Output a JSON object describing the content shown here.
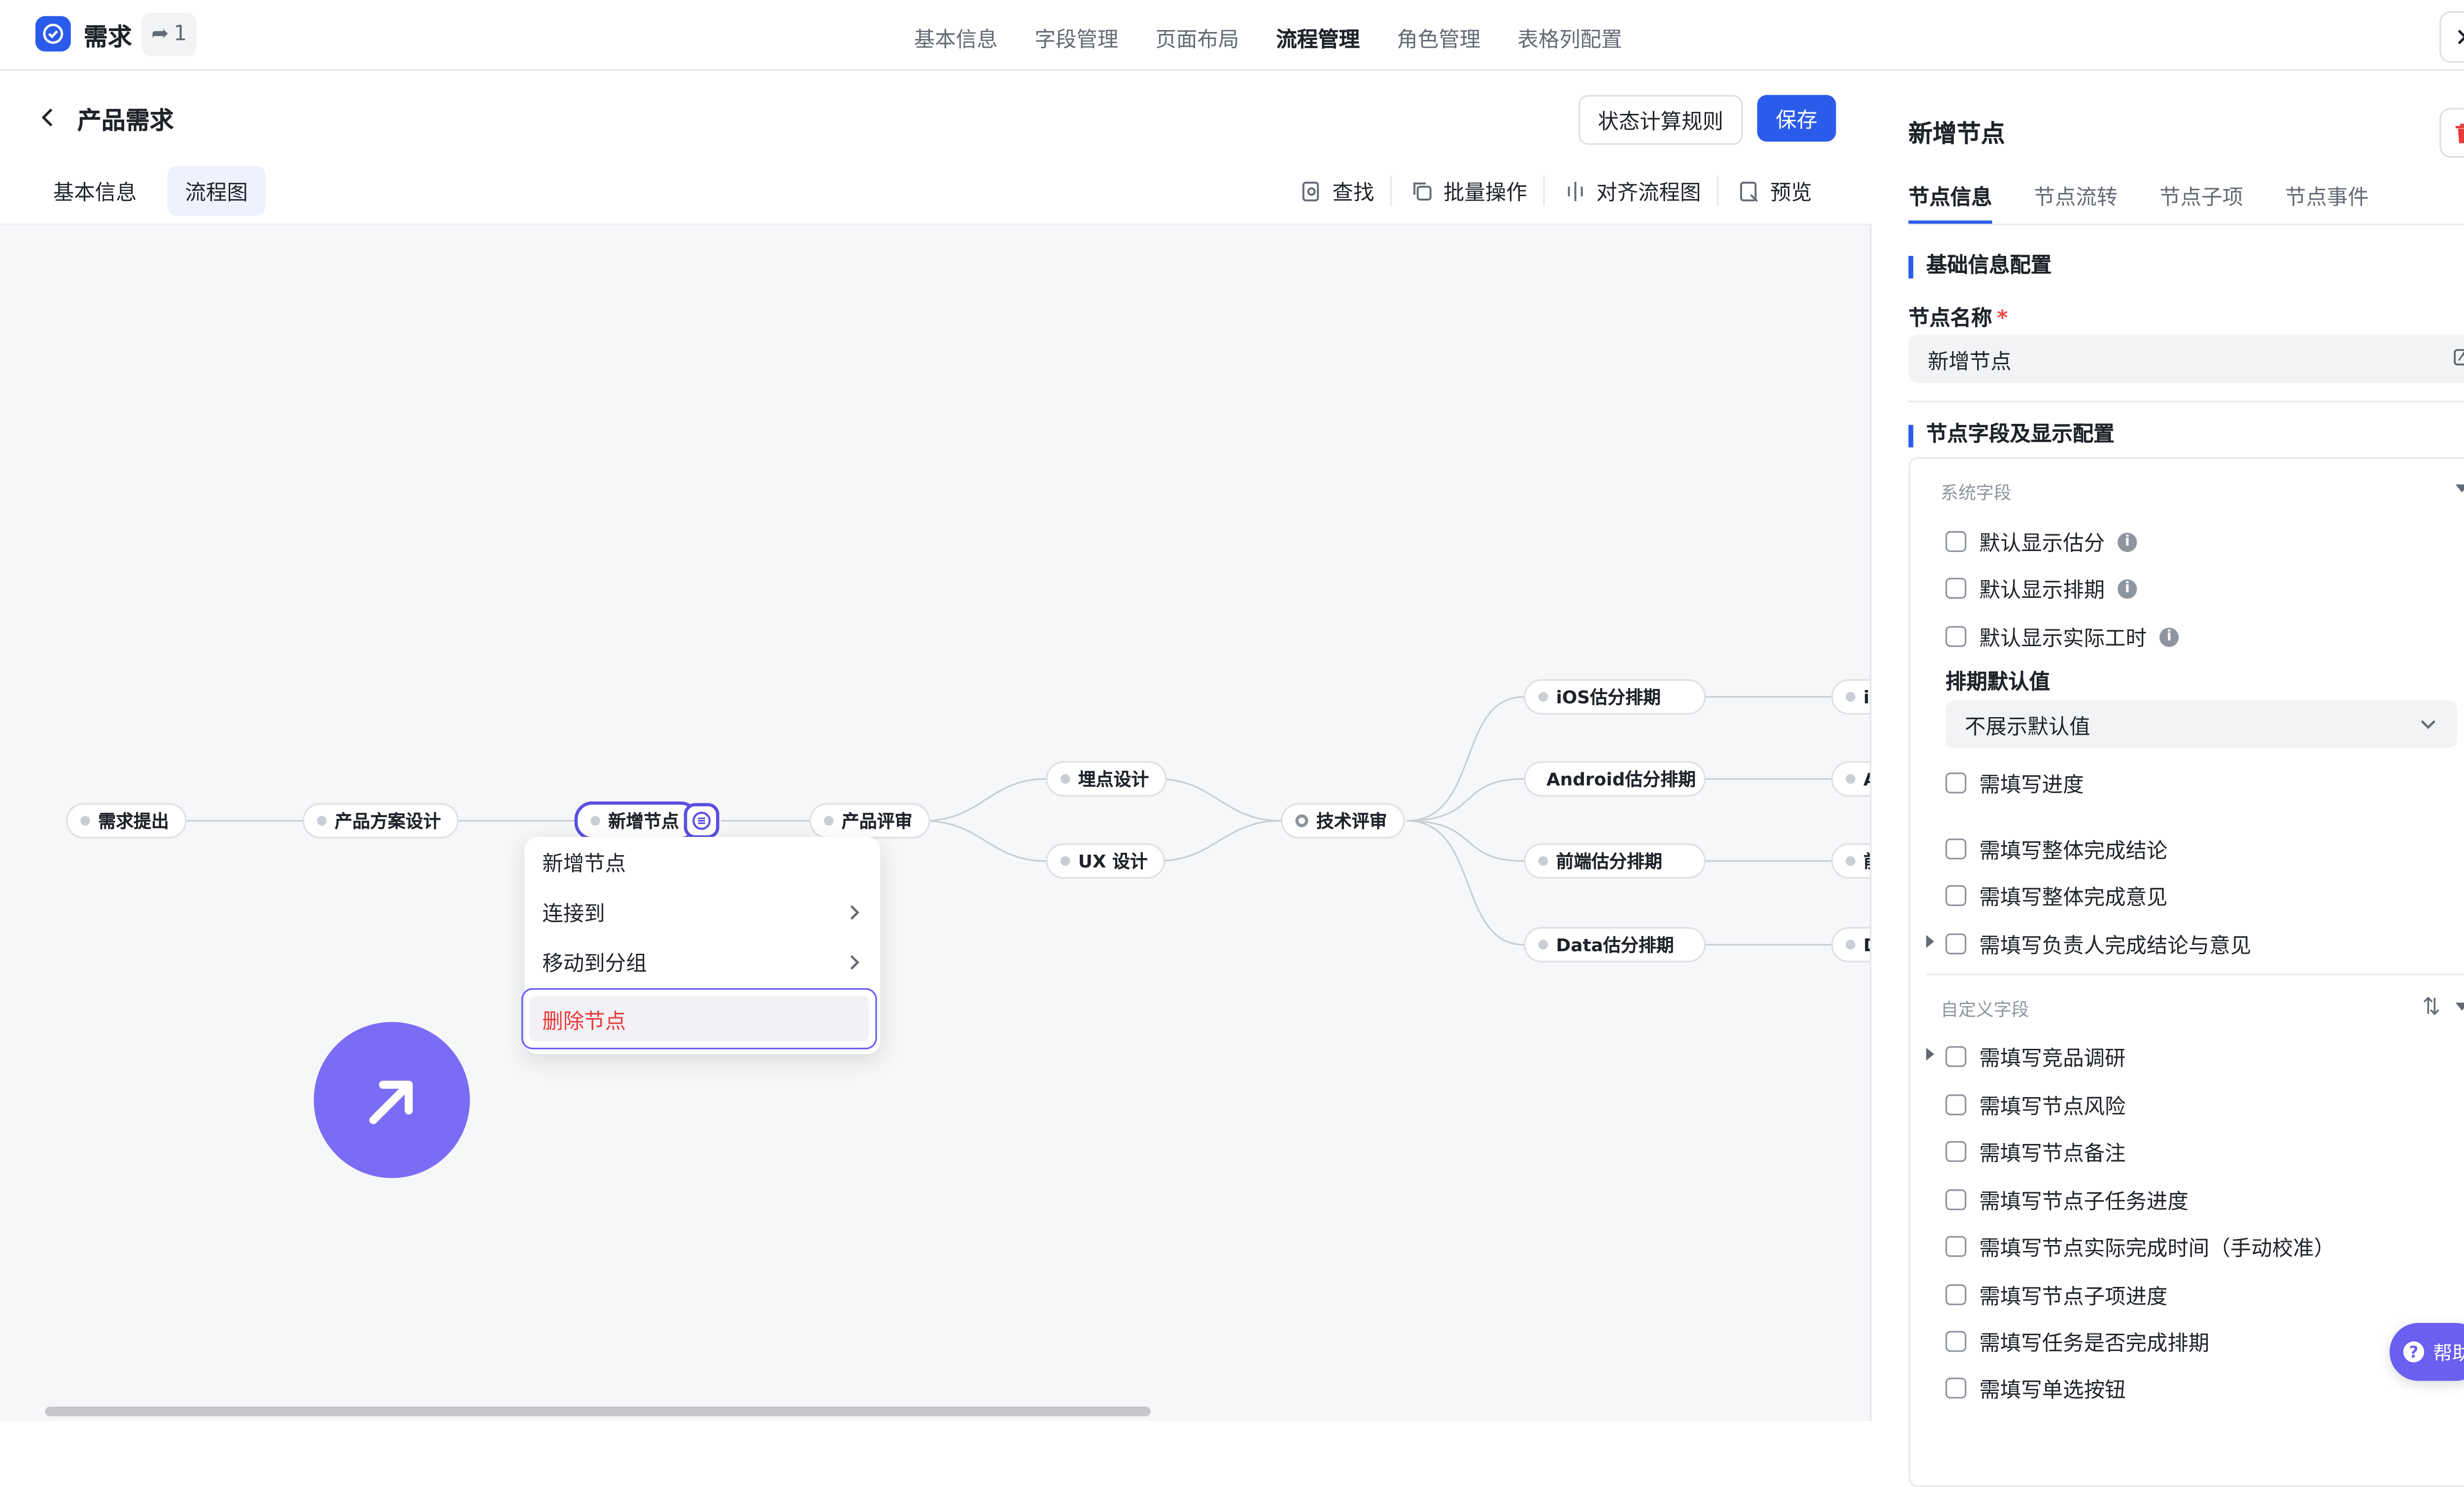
{
  "app": {
    "title": "需求",
    "share_count": "1",
    "accent": "#2b5bea",
    "menu_accent": "#6a5ff0"
  },
  "top_tabs": [
    "基本信息",
    "字段管理",
    "页面布局",
    "流程管理",
    "角色管理",
    "表格列配置"
  ],
  "header": {
    "page_title": "产品需求",
    "rule_button": "状态计算规则",
    "save_button": "保存"
  },
  "sub_tabs": [
    "基本信息",
    "流程图"
  ],
  "toolbar": [
    "查找",
    "批量操作",
    "对齐流程图",
    "预览"
  ],
  "flow": {
    "nodes": [
      "需求提出",
      "产品方案设计",
      "新增节点",
      "产品评审",
      "埋点设计",
      "UX 设计",
      "技术评审",
      "iOS估分排期",
      "Android估分排期",
      "前端估分排期",
      "Data估分排期"
    ],
    "clipped_nodes": [
      "iC",
      "A",
      "前",
      "D"
    ]
  },
  "context_menu": {
    "add_node": "新增节点",
    "connect_to": "连接到",
    "move_to_group": "移动到分组",
    "delete_node": "删除节点"
  },
  "panel": {
    "title": "新增节点",
    "tabs": [
      "节点信息",
      "节点流转",
      "节点子项",
      "节点事件"
    ],
    "basic_section": "基础信息配置",
    "name_label": "节点名称",
    "required_mark": "*",
    "name_value": "新增节点",
    "fields_section": "节点字段及显示配置",
    "system_group": "系统字段",
    "system_fields_top": [
      "默认显示估分",
      "默认显示排期",
      "默认显示实际工时"
    ],
    "schedule_default_label": "排期默认值",
    "schedule_default_value": "不展示默认值",
    "system_fields_bottom": [
      "需填写进度",
      "需填写整体完成结论",
      "需填写整体完成意见",
      "需填写负责人完成结论与意见"
    ],
    "custom_group": "自定义字段",
    "custom_fields": [
      "需填写竞品调研",
      "需填写节点风险",
      "需填写节点备注",
      "需填写节点子任务进度",
      "需填写节点实际完成时间（手动校准）",
      "需填写节点子项进度",
      "需填写任务是否完成排期",
      "需填写单选按钮"
    ]
  },
  "help": "帮助"
}
